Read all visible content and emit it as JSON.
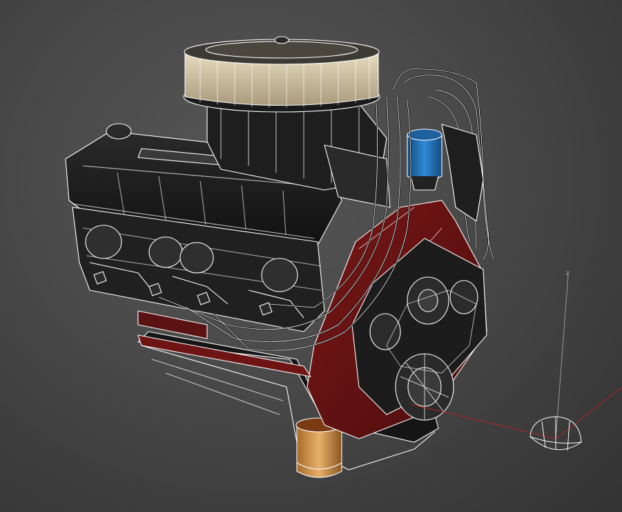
{
  "viewport": {
    "background_colors": [
      "#565656",
      "#3c3c3c"
    ],
    "wire_color": "#ffffff",
    "block_red": "#6e1414",
    "distributor_blue": "#1f6fb8",
    "filter_orange": "#d9a25a",
    "object": "engine-wireframe-model",
    "gizmo": {
      "z_label": "z",
      "z_axis_color": "#9a9a9a",
      "x_axis_color": "#b32424"
    }
  }
}
